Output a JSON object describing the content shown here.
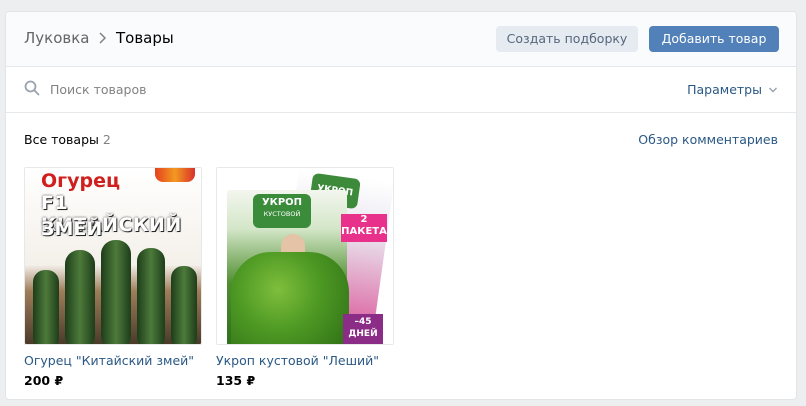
{
  "header": {
    "breadcrumb": [
      "Луковка",
      "Товары"
    ],
    "create_collection_label": "Создать подборку",
    "add_product_label": "Добавить товар"
  },
  "search": {
    "placeholder": "Поиск товаров",
    "value": "",
    "params_label": "Параметры"
  },
  "section": {
    "title": "Все товары",
    "count": "2",
    "overview_link": "Обзор комментариев"
  },
  "products": [
    {
      "name": "Огурец \"Китайский змей\"",
      "price": "200 ₽",
      "image_lines": [
        "Огурец",
        "F1 КИТАЙСКИЙ",
        "ЗМЕЙ"
      ]
    },
    {
      "name": "Укроп кустовой \"Леший\"",
      "price": "135 ₽",
      "image_lines": [
        "УКРОП",
        "КУСТОВОЙ",
        "УКРОП",
        "2 ПАКЕТА",
        "–45 ДНЕЙ"
      ]
    }
  ],
  "colors": {
    "page_bg": "#edeef0",
    "primary_button": "#5181b8",
    "secondary_button": "#e5ebf1",
    "link": "#2a5885"
  }
}
